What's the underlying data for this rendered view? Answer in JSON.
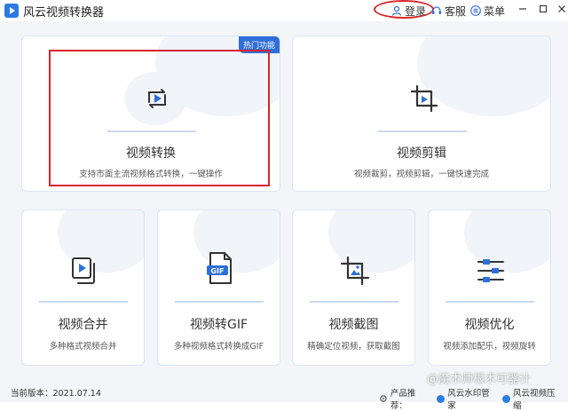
{
  "window": {
    "title": "风云视频转换器",
    "login_label": "登录",
    "service_label": "客服",
    "menu_label": "菜单"
  },
  "cards": {
    "convert": {
      "badge": "热门功能",
      "title": "视频转换",
      "desc": "支持市面主流视频格式转换，一键操作"
    },
    "cut": {
      "title": "视频剪辑",
      "desc": "视频裁剪，视频剪辑，一键快速完成"
    },
    "merge": {
      "title": "视频合并",
      "desc": "多种格式视频合并"
    },
    "gif": {
      "title": "视频转GIF",
      "desc": "多种视频格式转换成GIF",
      "icon_text": "GIF"
    },
    "crop": {
      "title": "视频截图",
      "desc": "精确定位视频，获取截图"
    },
    "optimize": {
      "title": "视频优化",
      "desc": "视频添加配乐，视频旋转"
    }
  },
  "footer": {
    "version": "当前版本：2021.07.14",
    "promo_label": "产品推荐：",
    "promo_item_1": "风云水印管家",
    "promo_item_2": "风云视频压缩"
  },
  "watermark": "@魔术师根术可器计",
  "colors": {
    "accent": "#2e6fd9",
    "annotation_red": "#d9252a"
  }
}
